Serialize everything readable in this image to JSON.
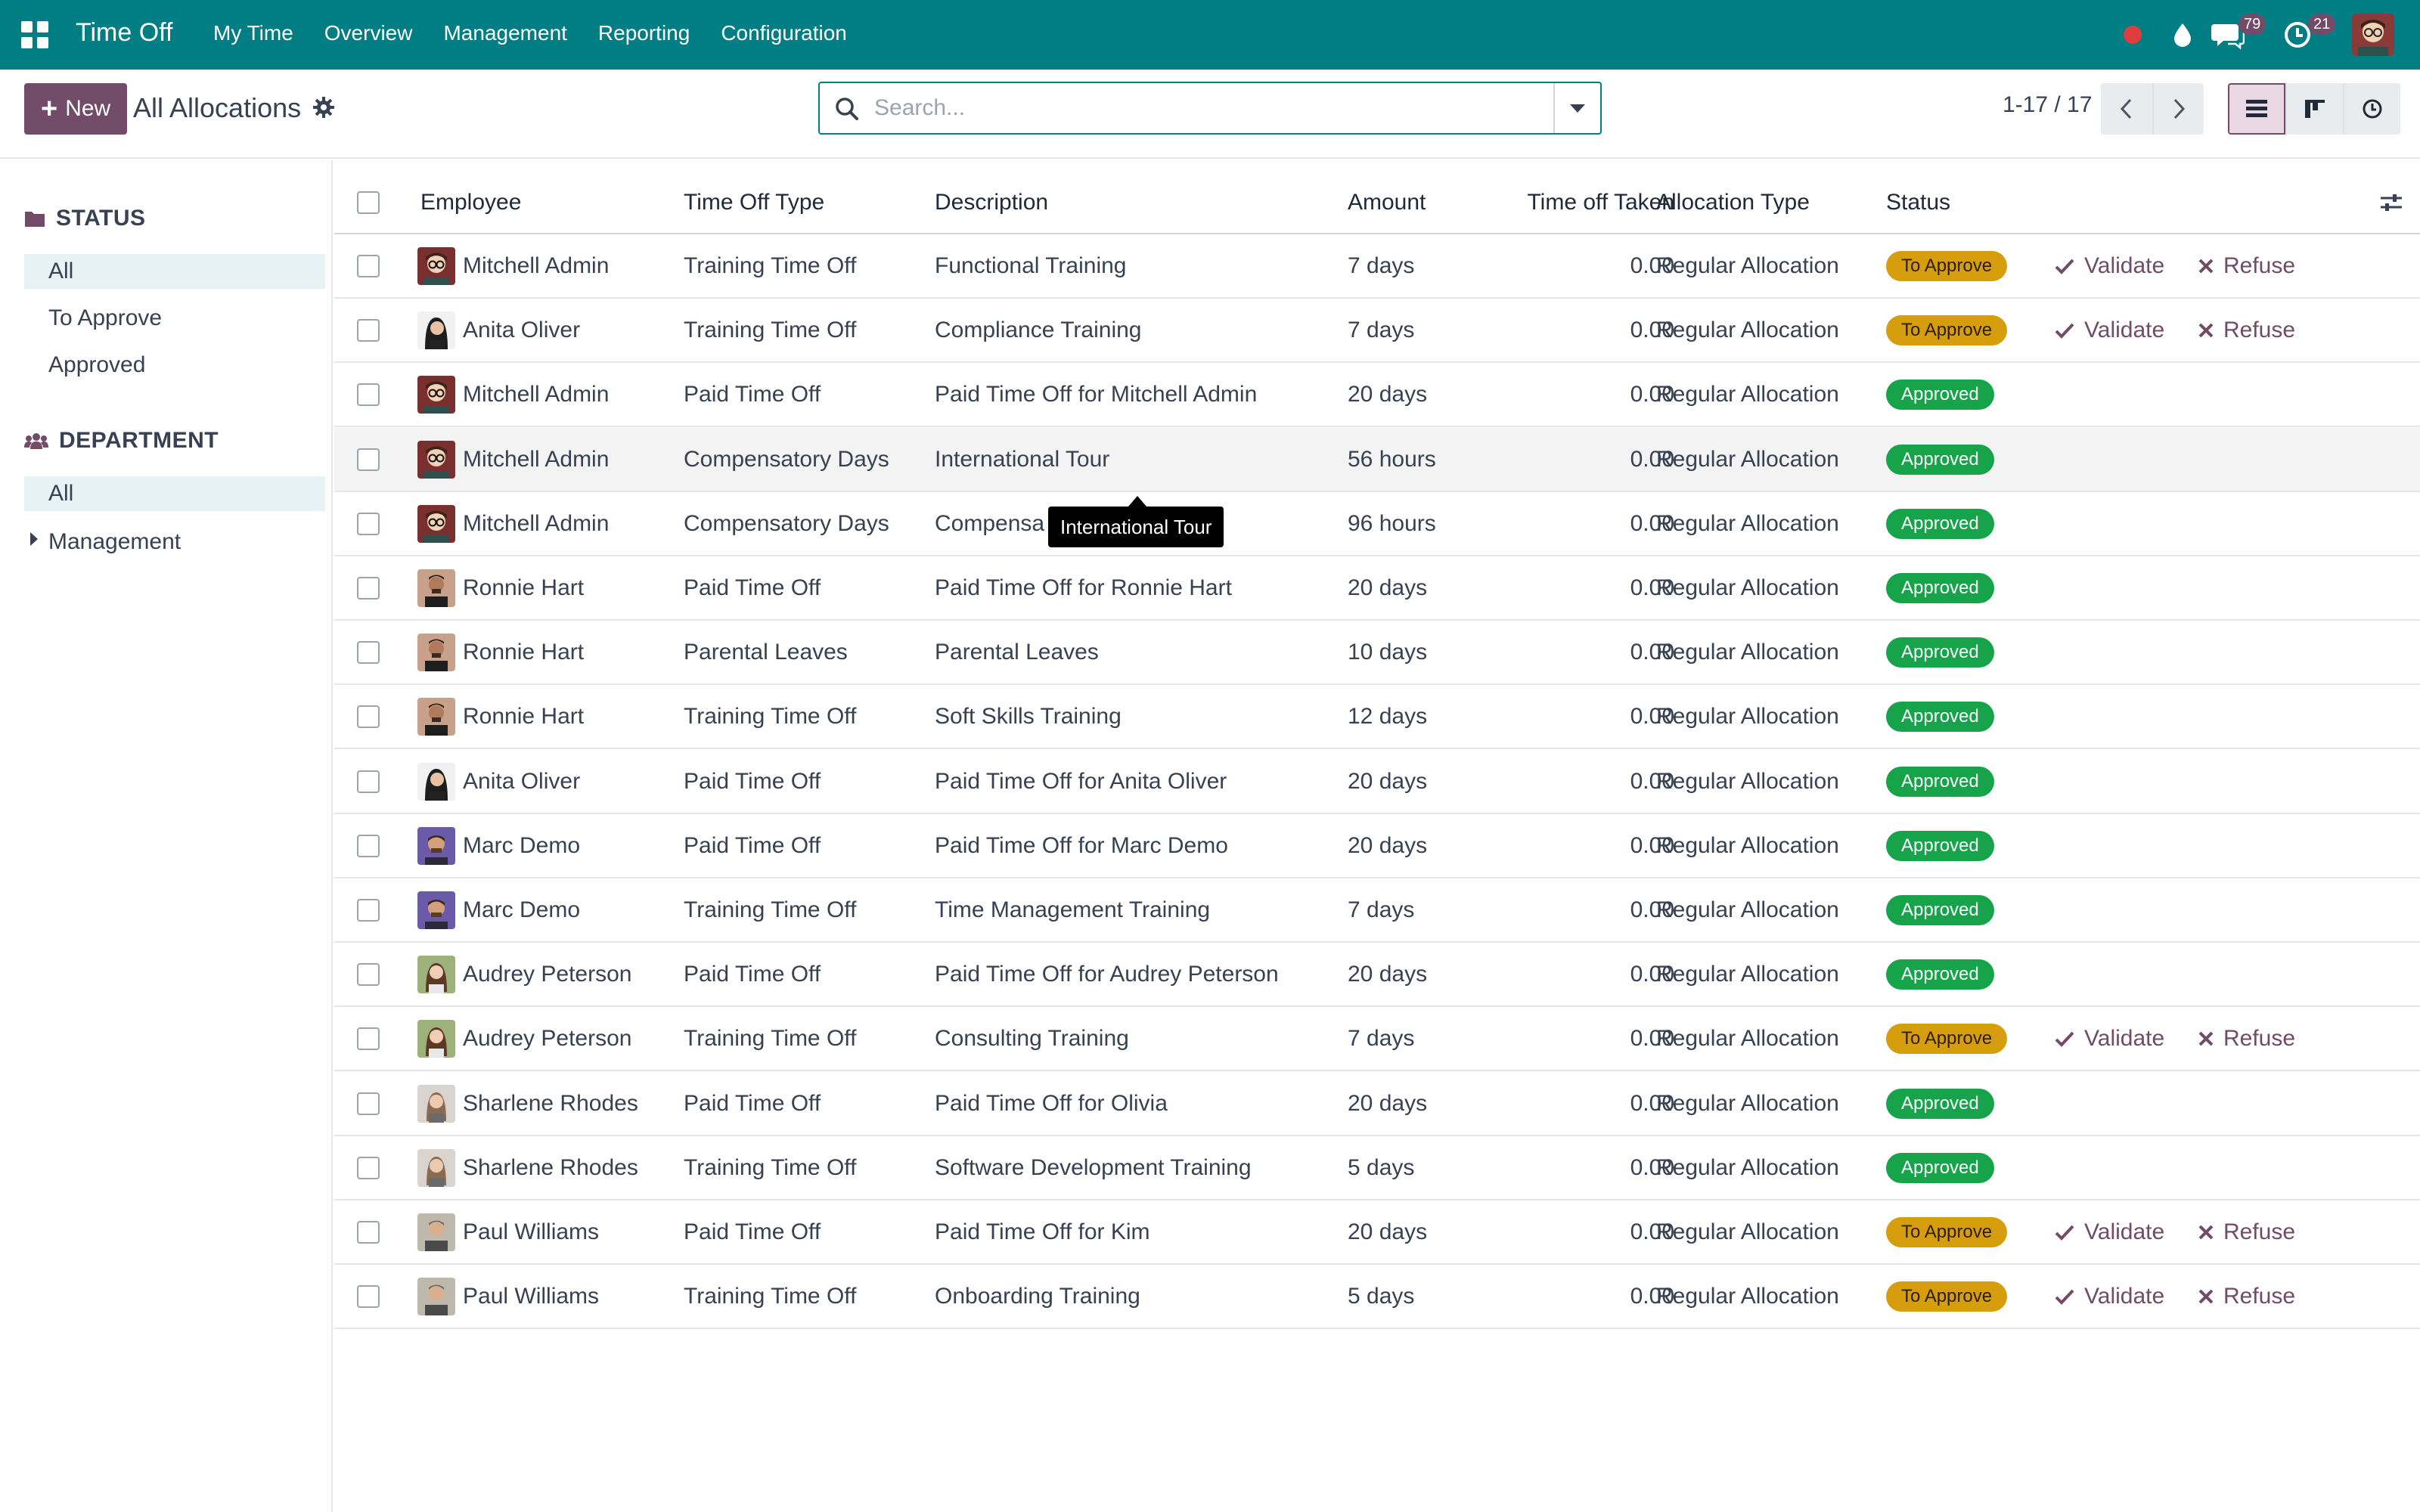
{
  "navbar": {
    "brand": "Time Off",
    "menu": [
      "My Time",
      "Overview",
      "Management",
      "Reporting",
      "Configuration"
    ],
    "chat_count": "79",
    "activity_count": "21",
    "color": "#017e84"
  },
  "control_panel": {
    "new_label": "New",
    "title": "All Allocations",
    "search_placeholder": "Search...",
    "pager": "1-17 / 17"
  },
  "sidepanel": {
    "status_heading": "STATUS",
    "status_items": [
      "All",
      "To Approve",
      "Approved"
    ],
    "department_heading": "DEPARTMENT",
    "department_items": [
      "All",
      "Management"
    ]
  },
  "table": {
    "headers": [
      "Employee",
      "Time Off Type",
      "Description",
      "Amount",
      "Time off Taken",
      "Allocation Type",
      "Status"
    ],
    "validate_label": "Validate",
    "refuse_label": "Refuse",
    "rows": [
      {
        "employee": "Mitchell Admin",
        "avatar": "mitchell",
        "type": "Training Time Off",
        "description": "Functional Training",
        "amount": "7 days",
        "taken": "0.00",
        "alloc": "Regular Allocation",
        "status": "To Approve"
      },
      {
        "employee": "Anita Oliver",
        "avatar": "anita",
        "type": "Training Time Off",
        "description": "Compliance Training",
        "amount": "7 days",
        "taken": "0.00",
        "alloc": "Regular Allocation",
        "status": "To Approve"
      },
      {
        "employee": "Mitchell Admin",
        "avatar": "mitchell",
        "type": "Paid Time Off",
        "description": "Paid Time Off for Mitchell Admin",
        "amount": "20 days",
        "taken": "0.00",
        "alloc": "Regular Allocation",
        "status": "Approved"
      },
      {
        "employee": "Mitchell Admin",
        "avatar": "mitchell",
        "type": "Compensatory Days",
        "description": "International Tour",
        "amount": "56 hours",
        "taken": "0.00",
        "alloc": "Regular Allocation",
        "status": "Approved"
      },
      {
        "employee": "Mitchell Admin",
        "avatar": "mitchell",
        "type": "Compensatory Days",
        "description": "Compensa",
        "amount": "96 hours",
        "taken": "0.00",
        "alloc": "Regular Allocation",
        "status": "Approved"
      },
      {
        "employee": "Ronnie Hart",
        "avatar": "ronnie",
        "type": "Paid Time Off",
        "description": "Paid Time Off for Ronnie Hart",
        "amount": "20 days",
        "taken": "0.00",
        "alloc": "Regular Allocation",
        "status": "Approved"
      },
      {
        "employee": "Ronnie Hart",
        "avatar": "ronnie",
        "type": "Parental Leaves",
        "description": "Parental Leaves",
        "amount": "10 days",
        "taken": "0.00",
        "alloc": "Regular Allocation",
        "status": "Approved"
      },
      {
        "employee": "Ronnie Hart",
        "avatar": "ronnie",
        "type": "Training Time Off",
        "description": "Soft Skills Training",
        "amount": "12 days",
        "taken": "0.00",
        "alloc": "Regular Allocation",
        "status": "Approved"
      },
      {
        "employee": "Anita Oliver",
        "avatar": "anita",
        "type": "Paid Time Off",
        "description": "Paid Time Off for Anita Oliver",
        "amount": "20 days",
        "taken": "0.00",
        "alloc": "Regular Allocation",
        "status": "Approved"
      },
      {
        "employee": "Marc Demo",
        "avatar": "marc",
        "type": "Paid Time Off",
        "description": "Paid Time Off for Marc Demo",
        "amount": "20 days",
        "taken": "0.00",
        "alloc": "Regular Allocation",
        "status": "Approved"
      },
      {
        "employee": "Marc Demo",
        "avatar": "marc",
        "type": "Training Time Off",
        "description": "Time Management Training",
        "amount": "7 days",
        "taken": "0.00",
        "alloc": "Regular Allocation",
        "status": "Approved"
      },
      {
        "employee": "Audrey Peterson",
        "avatar": "audrey",
        "type": "Paid Time Off",
        "description": "Paid Time Off for Audrey Peterson",
        "amount": "20 days",
        "taken": "0.00",
        "alloc": "Regular Allocation",
        "status": "Approved"
      },
      {
        "employee": "Audrey Peterson",
        "avatar": "audrey",
        "type": "Training Time Off",
        "description": "Consulting Training",
        "amount": "7 days",
        "taken": "0.00",
        "alloc": "Regular Allocation",
        "status": "To Approve"
      },
      {
        "employee": "Sharlene Rhodes",
        "avatar": "sharlene",
        "type": "Paid Time Off",
        "description": "Paid Time Off for Olivia",
        "amount": "20 days",
        "taken": "0.00",
        "alloc": "Regular Allocation",
        "status": "Approved"
      },
      {
        "employee": "Sharlene Rhodes",
        "avatar": "sharlene",
        "type": "Training Time Off",
        "description": "Software Development Training",
        "amount": "5 days",
        "taken": "0.00",
        "alloc": "Regular Allocation",
        "status": "Approved"
      },
      {
        "employee": "Paul Williams",
        "avatar": "paul",
        "type": "Paid Time Off",
        "description": "Paid Time Off for Kim",
        "amount": "20 days",
        "taken": "0.00",
        "alloc": "Regular Allocation",
        "status": "To Approve"
      },
      {
        "employee": "Paul Williams",
        "avatar": "paul",
        "type": "Training Time Off",
        "description": "Onboarding Training",
        "amount": "5 days",
        "taken": "0.00",
        "alloc": "Regular Allocation",
        "status": "To Approve"
      }
    ]
  },
  "tooltip": {
    "text": "International Tour"
  }
}
